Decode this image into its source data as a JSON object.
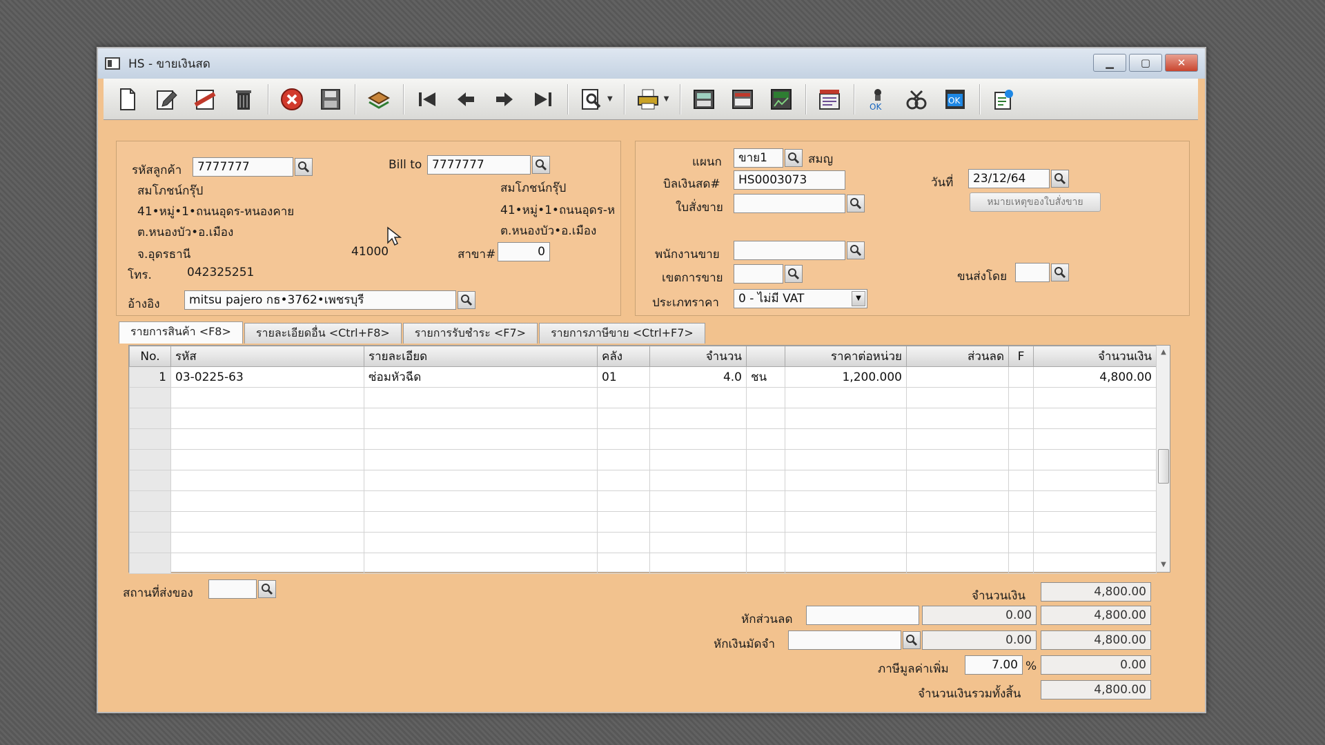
{
  "window": {
    "title": "HS - ขายเงินสด"
  },
  "customer": {
    "code_label": "รหัสลูกค้า",
    "code": "7777777",
    "name": "สมโภชน์กรุ๊ป",
    "address1": "41•หมู่•1•ถนนอุดร-หนองคาย",
    "address2": "ต.หนองบัว•อ.เมือง",
    "province": "จ.อุดรธานี",
    "postcode": "41000",
    "phone_label": "โทร.",
    "phone": "042325251",
    "ref_label": "อ้างอิง",
    "ref": "mitsu pajero กธ•3762•เพชรบุรี"
  },
  "bill_to": {
    "label": "Bill to",
    "code": "7777777",
    "name": "สมโภชน์กรุ๊ป",
    "address1": "41•หมู่•1•ถนนอุดร-ห",
    "address2": "ต.หนองบัว•อ.เมือง",
    "branch_label": "สาขา#",
    "branch": "0"
  },
  "doc": {
    "dept_label": "แผนก",
    "dept": "ขาย1",
    "dept_name": "สมญ",
    "bill_label": "บิลเงินสด#",
    "bill_no": "HS0003073",
    "order_label": "ใบสั่งขาย",
    "order_no": "",
    "date_label": "วันที่",
    "date": "23/12/64",
    "order_note_button": "หมายเหตุของใบสั่งขาย",
    "salesman_label": "พนักงานขาย",
    "salesman": "",
    "area_label": "เขตการขาย",
    "area": "",
    "ship_by_label": "ขนส่งโดย",
    "ship_by": "",
    "price_type_label": "ประเภทราคา",
    "price_type": "0 - ไม่มี VAT"
  },
  "tabs": [
    {
      "label": "รายการสินค้า <F8>"
    },
    {
      "label": "รายละเอียดอื่น <Ctrl+F8>"
    },
    {
      "label": "รายการรับชำระ <F7>"
    },
    {
      "label": "รายการภาษีขาย <Ctrl+F7>"
    }
  ],
  "grid": {
    "headers": [
      "No.",
      "รหัส",
      "รายละเอียด",
      "คลัง",
      "จำนวน",
      "",
      "ราคาต่อหน่วย",
      "ส่วนลด",
      "F",
      "จำนวนเงิน"
    ],
    "rows": [
      [
        "1",
        "03-0225-63",
        "ซ่อมหัวฉีด",
        "01",
        "4.0",
        "ชน",
        "1,200.000",
        "",
        "",
        "4,800.00"
      ]
    ]
  },
  "footer": {
    "ship_place_label": "สถานที่ส่งของ",
    "ship_place": "",
    "amount_label": "จำนวนเงิน",
    "amount": "4,800.00",
    "discount_label": "หักส่วนลด",
    "discount_text": "",
    "discount_value": "0.00",
    "after_discount": "4,800.00",
    "deposit_label": "หักเงินมัดจำ",
    "deposit_text": "",
    "deposit_value": "0.00",
    "after_deposit": "4,800.00",
    "vat_label": "ภาษีมูลค่าเพิ่ม",
    "vat_rate": "7.00",
    "vat_pct": "%",
    "vat_amount": "0.00",
    "total_label": "จำนวนเงินรวมทั้งสิ้น",
    "total": "4,800.00"
  },
  "icons": [
    "new-doc-icon",
    "edit-icon",
    "cancel-doc-icon",
    "delete-icon",
    "close-icon",
    "save-icon",
    "stack-icon",
    "first-icon",
    "prev-icon",
    "next-icon",
    "last-icon",
    "search-doc-icon",
    "print-icon",
    "calc-icon",
    "register-icon",
    "report-icon",
    "refund-icon",
    "approve-icon",
    "tools-icon",
    "ok-icon",
    "export-icon"
  ]
}
